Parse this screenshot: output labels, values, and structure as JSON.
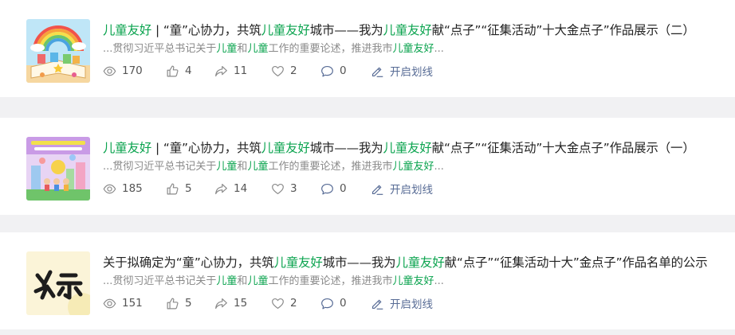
{
  "articles": [
    {
      "title": {
        "p1": "儿童友好",
        "p2": " | “童”心协力，共筑",
        "p3": "儿童友好",
        "p4": "城市——我为",
        "p5": "儿童友好",
        "p6": "献“点子”“征集活动”十大金点子”作品展示（二）"
      },
      "summary": {
        "s1": "...贯彻习近平总书记关于",
        "s2": "儿童",
        "s3": "和",
        "s4": "儿童",
        "s5": "工作的重要论述，推进我市",
        "s6": "儿童友好",
        "s7": "..."
      },
      "stats": {
        "views": "170",
        "likes": "4",
        "shares": "11",
        "favorites": "2",
        "comments": "0",
        "mark": "开启划线"
      },
      "thumbnail_icon": "rainbow-book-illustration"
    },
    {
      "title": {
        "p1": "儿童友好",
        "p2": " | “童”心协力，共筑",
        "p3": "儿童友好",
        "p4": "城市——我为",
        "p5": "儿童友好",
        "p6": "献“点子”“征集活动”十大金点子”作品展示（一）"
      },
      "summary": {
        "s1": "...贯彻习近平总书记关于",
        "s2": "儿童",
        "s3": "和",
        "s4": "儿童",
        "s5": "工作的重要论述，推进我市",
        "s6": "儿童友好",
        "s7": "..."
      },
      "stats": {
        "views": "185",
        "likes": "5",
        "shares": "14",
        "favorites": "3",
        "comments": "0",
        "mark": "开启划线"
      },
      "thumbnail_icon": "children-city-illustration"
    },
    {
      "title": {
        "p1": "关于拟确定为“童”心协力，共筑",
        "p2": "儿童友好",
        "p3": "城市——我为",
        "p4": "儿童友好",
        "p5": "献“点子”“征集活动十大”金点子”作品名单的公示",
        "p6": ""
      },
      "summary": {
        "s1": "...贯彻习近平总书记关于",
        "s2": "儿童",
        "s3": "和",
        "s4": "儿童",
        "s5": "工作的重要论述，推进我市",
        "s6": "儿童友好",
        "s7": "..."
      },
      "stats": {
        "views": "151",
        "likes": "5",
        "shares": "15",
        "favorites": "2",
        "comments": "0",
        "mark": "开启划线"
      },
      "thumbnail_icon": "gongshi-calligraphy"
    }
  ],
  "colors": {
    "highlight": "#0aa34e",
    "mark_link": "#576b95",
    "summary": "#8a8a8a",
    "background": "#f1f1f3"
  }
}
